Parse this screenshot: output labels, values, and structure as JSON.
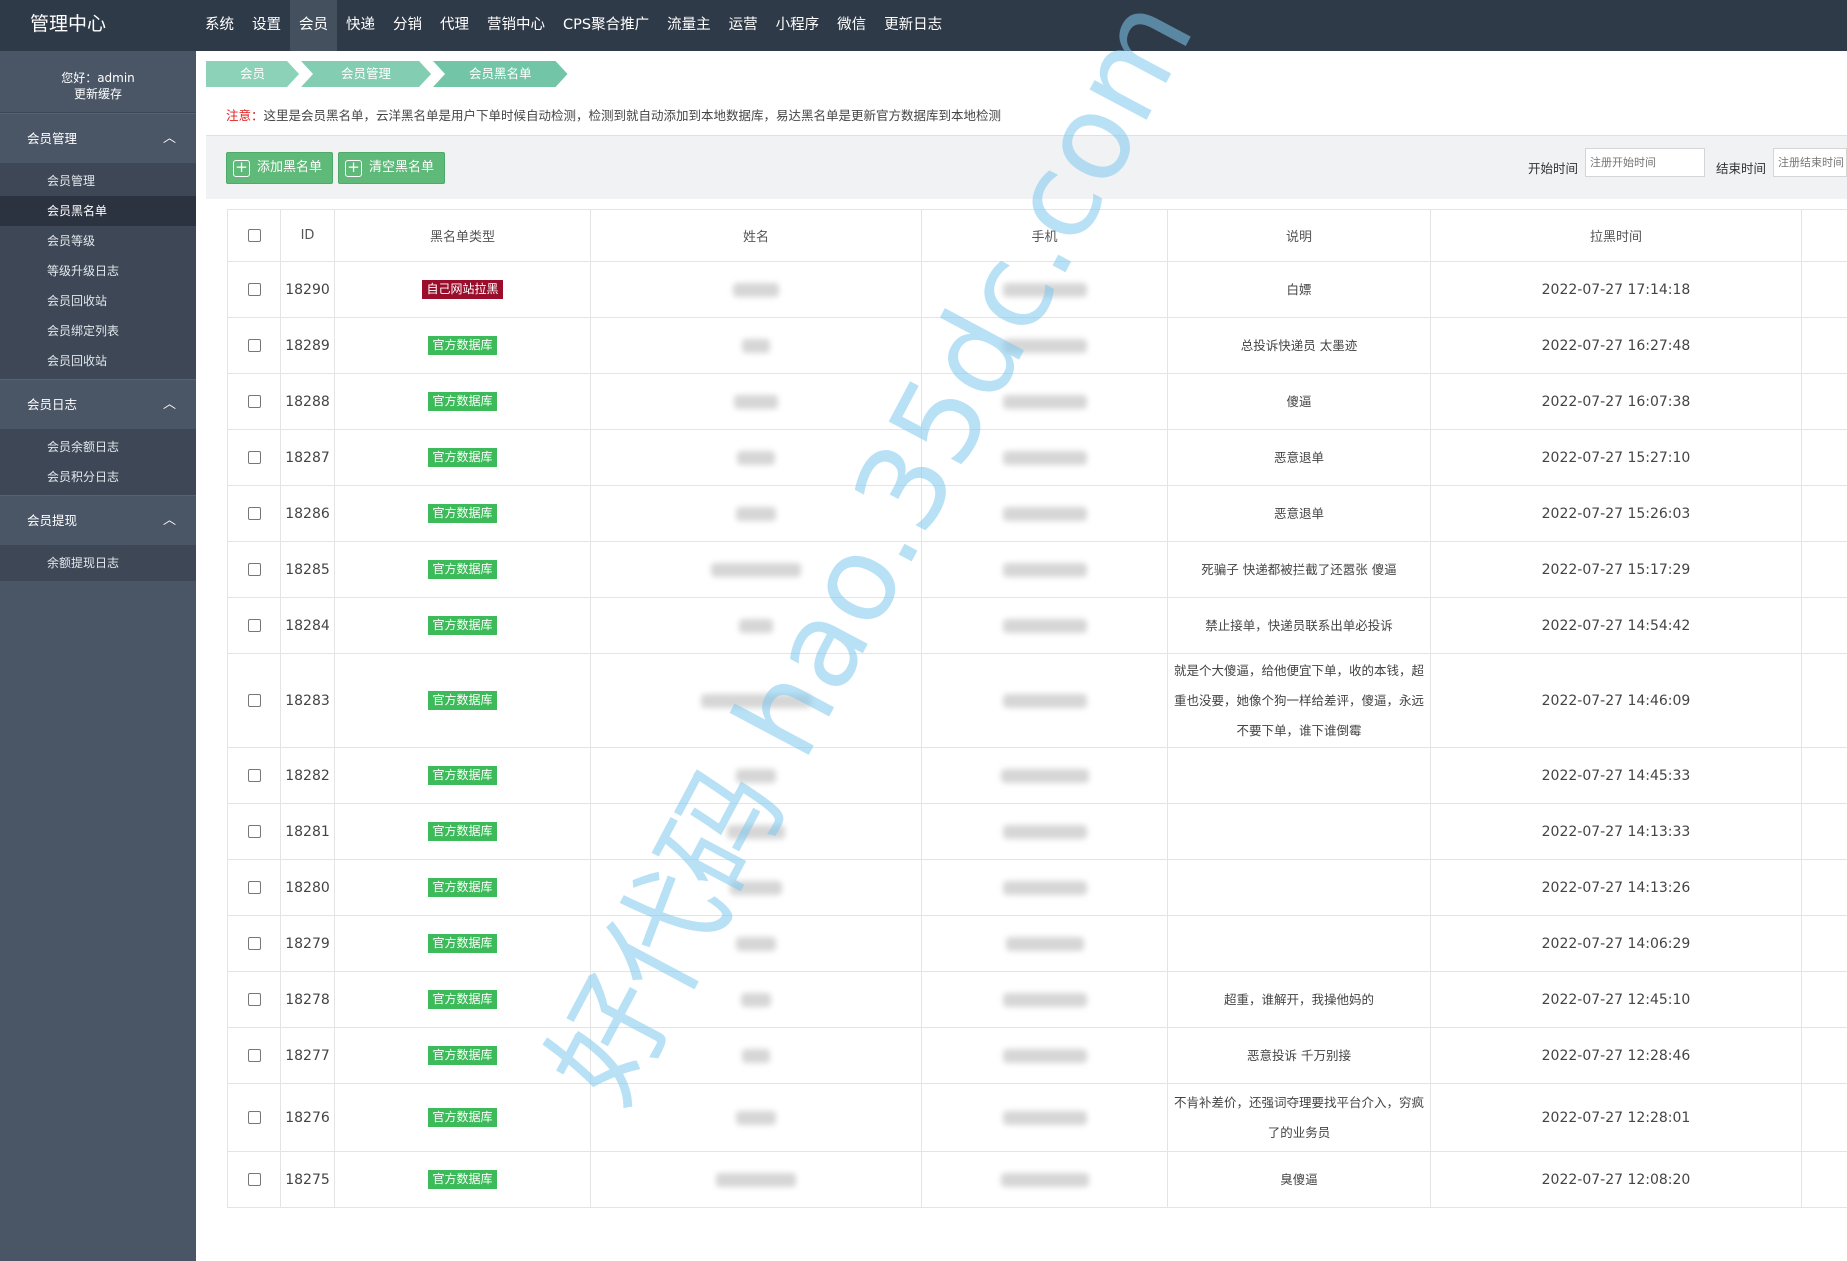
{
  "app": {
    "title": "管理中心",
    "nav": [
      "系统",
      "设置",
      "会员",
      "快递",
      "分销",
      "代理",
      "营销中心",
      "CPS聚合推广",
      "流量主",
      "运营",
      "小程序",
      "微信",
      "更新日志"
    ],
    "nav_active": "会员"
  },
  "sidebar": {
    "greeting": "您好：admin",
    "refresh_cache": "更新缓存",
    "groups": [
      {
        "label": "会员管理",
        "items": [
          "会员管理",
          "会员黑名单",
          "会员等级",
          "等级升级日志",
          "会员回收站",
          "会员绑定列表",
          "会员回收站"
        ],
        "active": "会员黑名单"
      },
      {
        "label": "会员日志",
        "items": [
          "会员余额日志",
          "会员积分日志"
        ]
      },
      {
        "label": "会员提现",
        "items": [
          "余额提现日志"
        ]
      }
    ]
  },
  "breadcrumb": [
    "会员",
    "会员管理",
    "会员黑名单"
  ],
  "notice": {
    "label": "注意：",
    "text": "这里是会员黑名单，云洋黑名单是用户下单时候自动检测，检测到就自动添加到本地数据库，易达黑名单是更新官方数据库到本地检测"
  },
  "toolbar": {
    "add_label": "添加黑名单",
    "clear_label": "清空黑名单",
    "start_label": "开始时间",
    "start_placeholder": "注册开始时间",
    "end_label": "结束时间",
    "end_placeholder": "注册结束时间"
  },
  "table": {
    "headers": [
      "ID",
      "黑名单类型",
      "姓名",
      "手机",
      "说明",
      "拉黑时间"
    ],
    "rows": [
      {
        "id": "18290",
        "type": "自己网站拉黑",
        "type_style": "red",
        "note": "白嫖",
        "time": "2022-07-27 17:14:18"
      },
      {
        "id": "18289",
        "type": "官方数据库",
        "note": "总投诉快递员 太墨迹",
        "time": "2022-07-27 16:27:48"
      },
      {
        "id": "18288",
        "type": "官方数据库",
        "note": "傻逼",
        "time": "2022-07-27 16:07:38"
      },
      {
        "id": "18287",
        "type": "官方数据库",
        "note": "恶意退单",
        "time": "2022-07-27 15:27:10"
      },
      {
        "id": "18286",
        "type": "官方数据库",
        "note": "恶意退单",
        "time": "2022-07-27 15:26:03"
      },
      {
        "id": "18285",
        "type": "官方数据库",
        "note": "死骗子 快递都被拦截了还嚣张 傻逼",
        "time": "2022-07-27 15:17:29"
      },
      {
        "id": "18284",
        "type": "官方数据库",
        "note": "禁止接单，快递员联系出单必投诉",
        "time": "2022-07-27 14:54:42"
      },
      {
        "id": "18283",
        "type": "官方数据库",
        "note": "就是个大傻逼，给他便宜下单，收的本钱，超重也没要，她像个狗一样给差评，傻逼，永远不要下单，谁下谁倒霉",
        "time": "2022-07-27 14:46:09",
        "tall": true
      },
      {
        "id": "18282",
        "type": "官方数据库",
        "note": "",
        "time": "2022-07-27 14:45:33"
      },
      {
        "id": "18281",
        "type": "官方数据库",
        "note": "",
        "time": "2022-07-27 14:13:33"
      },
      {
        "id": "18280",
        "type": "官方数据库",
        "note": "",
        "time": "2022-07-27 14:13:26"
      },
      {
        "id": "18279",
        "type": "官方数据库",
        "note": "",
        "time": "2022-07-27 14:06:29"
      },
      {
        "id": "18278",
        "type": "官方数据库",
        "note": "超重，谁解开，我操他妈的",
        "time": "2022-07-27 12:45:10"
      },
      {
        "id": "18277",
        "type": "官方数据库",
        "note": "恶意投诉 千万别接",
        "time": "2022-07-27 12:28:46"
      },
      {
        "id": "18276",
        "type": "官方数据库",
        "note": "不肯补差价，还强词夺理要找平台介入，穷疯了的业务员",
        "time": "2022-07-27 12:28:01",
        "tall2": true
      },
      {
        "id": "18275",
        "type": "官方数据库",
        "note": "臭傻逼",
        "time": "2022-07-27 12:08:20"
      }
    ]
  },
  "watermark": "好代码 hao.35dc.com"
}
